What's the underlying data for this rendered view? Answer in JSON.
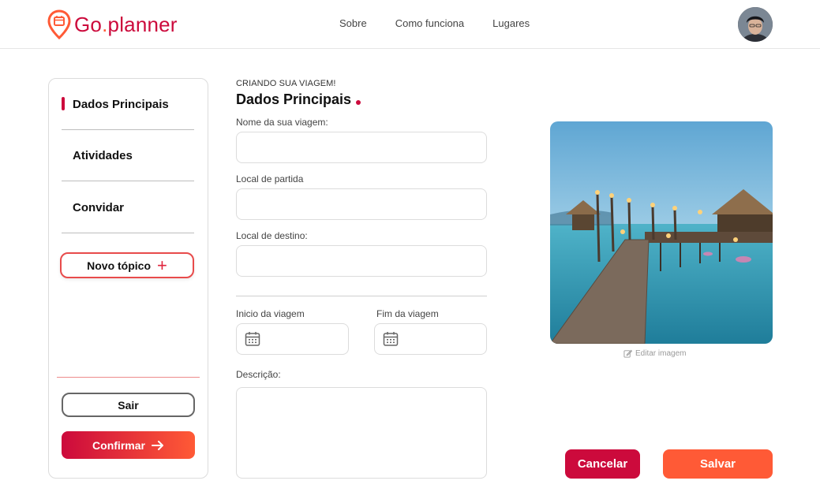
{
  "header": {
    "logo_main": "Go",
    "logo_dot": ".",
    "logo_suffix": "planner",
    "nav": [
      "Sobre",
      "Como funciona",
      "Lugares"
    ]
  },
  "sidebar": {
    "items": [
      {
        "label": "Dados Principais",
        "active": true
      },
      {
        "label": "Atividades",
        "active": false
      },
      {
        "label": "Convidar",
        "active": false
      }
    ],
    "new_topic_label": "Novo tópico",
    "exit_label": "Sair",
    "confirm_label": "Confirmar"
  },
  "form": {
    "eyebrow": "CRIANDO SUA VIAGEM!",
    "title": "Dados Principais",
    "trip_name_label": "Nome da sua viagem:",
    "departure_label": "Local de partida",
    "destination_label": "Local de destino:",
    "start_label": "Inicio da viagem",
    "end_label": "Fim da viagem",
    "description_label": "Descrição:"
  },
  "image": {
    "edit_label": "Editar imagem"
  },
  "actions": {
    "cancel_label": "Cancelar",
    "save_label": "Salvar"
  },
  "colors": {
    "brand_red": "#cc0a3c",
    "brand_orange": "#ff5a36"
  },
  "icons": [
    "location-pin-icon",
    "calendar-icon",
    "plus-icon",
    "arrow-right-icon",
    "edit-icon"
  ]
}
